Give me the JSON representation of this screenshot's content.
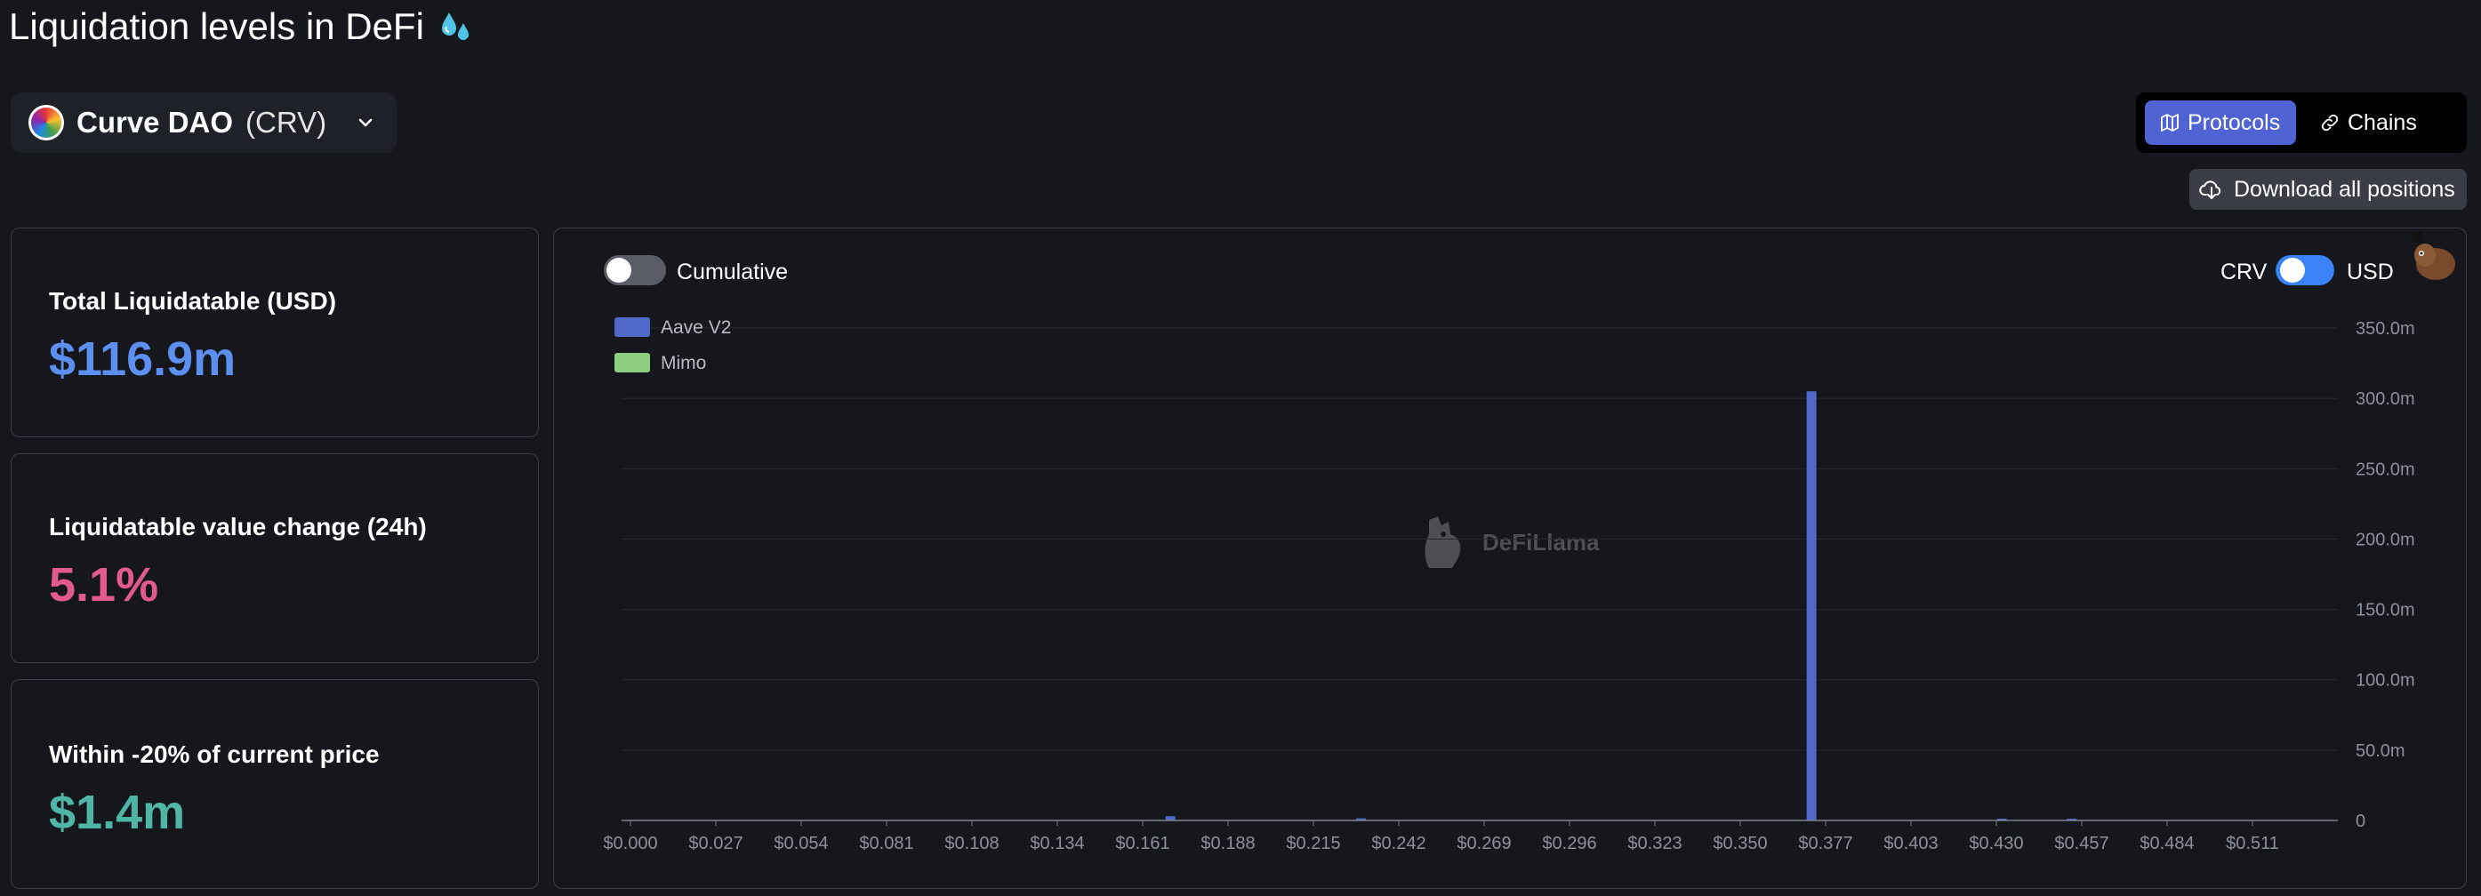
{
  "header": {
    "title": "Liquidation levels in DeFi"
  },
  "token": {
    "name": "Curve DAO",
    "symbol": "(CRV)"
  },
  "view_switch": {
    "protocols_label": "Protocols",
    "chains_label": "Chains",
    "active": "Protocols"
  },
  "download": {
    "label": "Download all positions"
  },
  "stats": [
    {
      "label": "Total Liquidatable (USD)",
      "value": "$116.9m",
      "color": "#5b8ff0"
    },
    {
      "label": "Liquidatable value change (24h)",
      "value": "5.1%",
      "color": "#e35b8d"
    },
    {
      "label": "Within -20% of current price",
      "value": "$1.4m",
      "color": "#4fb5a6"
    }
  ],
  "chart_controls": {
    "cumulative_label": "Cumulative",
    "cumulative_on": false,
    "currency_left": "CRV",
    "currency_right": "USD",
    "currency_usd_on": true
  },
  "watermark": "DeFiLlama",
  "colors": {
    "aave_v2": "#5069c9",
    "mimo": "#8ccf7e",
    "accent": "#4f63d2"
  },
  "chart_data": {
    "type": "bar",
    "stacked": true,
    "legend_placement": "top-left",
    "grid": true,
    "x_tick_labels": [
      "$0.000",
      "$0.027",
      "$0.054",
      "$0.081",
      "$0.108",
      "$0.134",
      "$0.161",
      "$0.188",
      "$0.215",
      "$0.242",
      "$0.269",
      "$0.296",
      "$0.323",
      "$0.350",
      "$0.377",
      "$0.403",
      "$0.430",
      "$0.457",
      "$0.484",
      "$0.511"
    ],
    "y_tick_labels": [
      "0",
      "50.0m",
      "100.0m",
      "150.0m",
      "200.0m",
      "250.0m",
      "300.0m",
      "350.0m"
    ],
    "ylim": [
      0,
      350
    ],
    "xlim": [
      0,
      0.538
    ],
    "series": [
      {
        "name": "Aave V2",
        "points": [
          {
            "x": 0.17,
            "y": 3
          },
          {
            "x": 0.23,
            "y": 1.5
          },
          {
            "x": 0.372,
            "y": 305
          },
          {
            "x": 0.432,
            "y": 1
          },
          {
            "x": 0.454,
            "y": 1
          }
        ]
      },
      {
        "name": "Mimo",
        "points": []
      }
    ]
  }
}
